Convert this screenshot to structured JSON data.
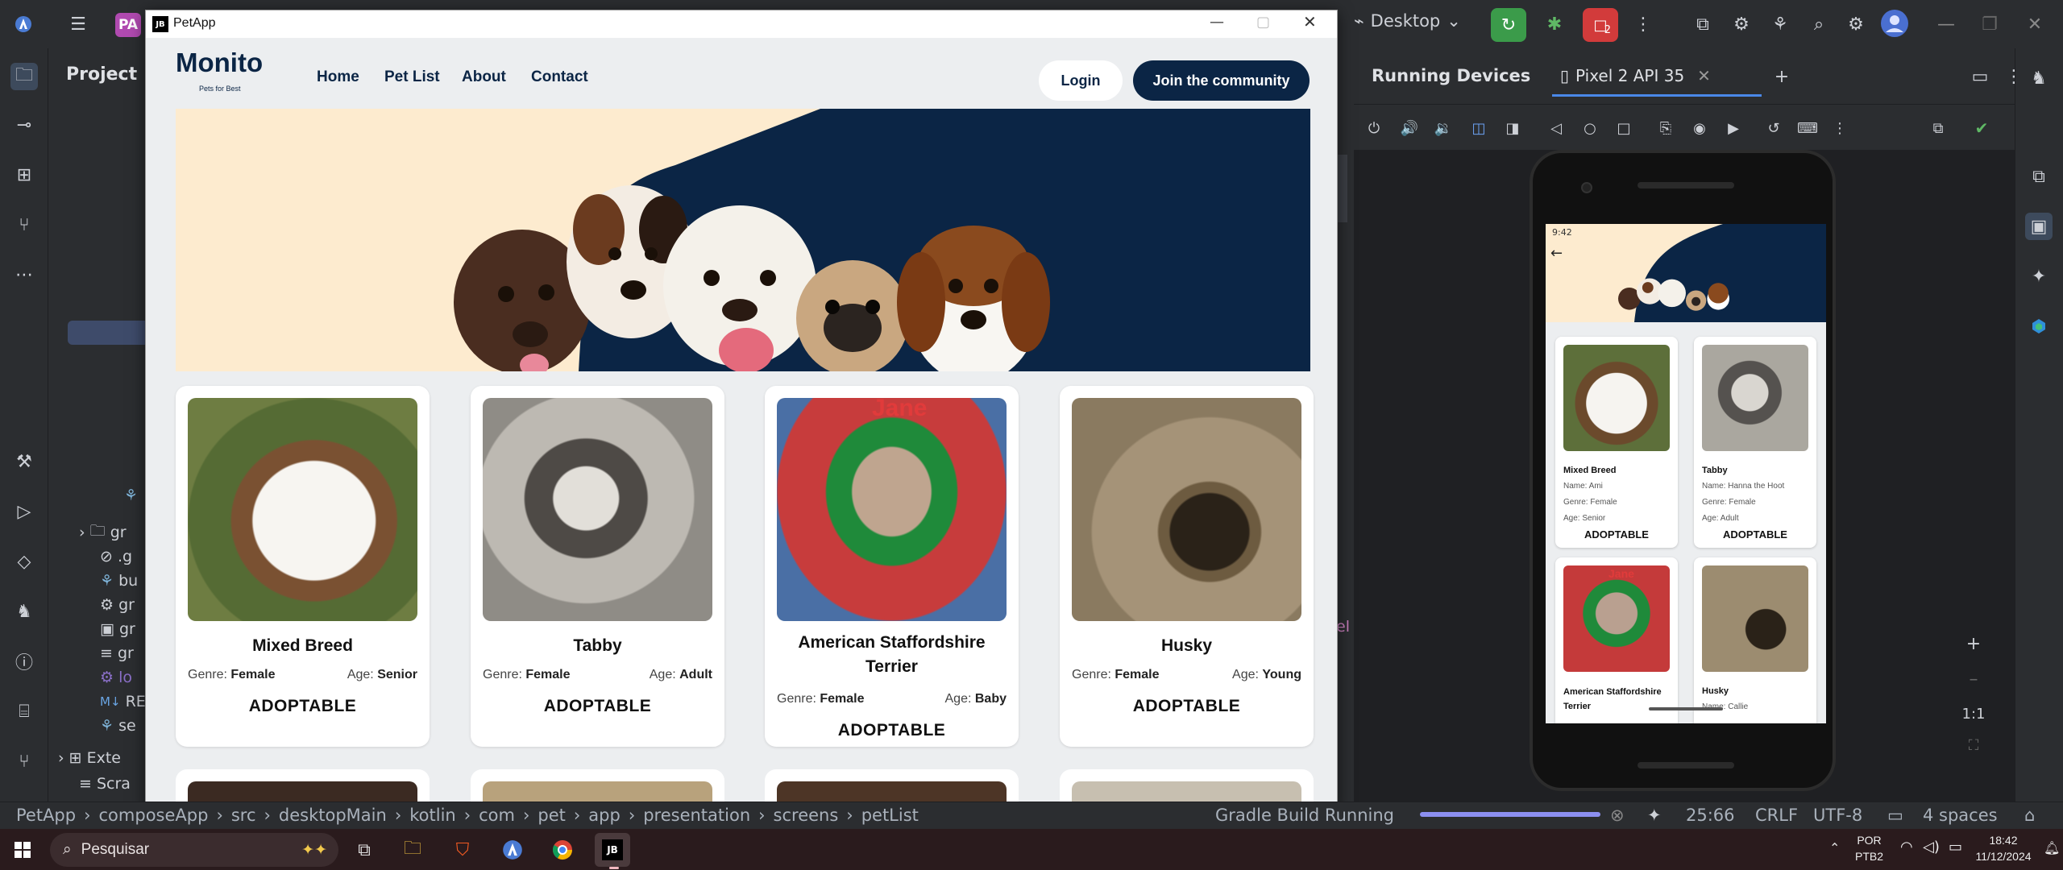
{
  "ide": {
    "project_badge": "PA",
    "project_tab": "Project",
    "run_config": "Desktop",
    "running_devices": "Running Devices",
    "device_tab": "Pixel 2 API 35",
    "zoom": "1:1",
    "el_fragment": "el",
    "tree": [
      "gr",
      ".g",
      "bu",
      "gr",
      "gr",
      "gr",
      "lo",
      "RE",
      "se",
      "Exte",
      "Scra"
    ],
    "status": {
      "breadcrumb": [
        "PetApp",
        "composeApp",
        "src",
        "desktopMain",
        "kotlin",
        "com",
        "pet",
        "app",
        "presentation",
        "screens",
        "petList"
      ],
      "build": "Gradle Build Running",
      "position": "25:66",
      "line_sep": "CRLF",
      "encoding": "UTF-8",
      "indent": "4 spaces"
    },
    "badges": {
      "alerts": "2"
    },
    "colors": {
      "accent_green": "#3b9b4a",
      "accent_red": "#d23b3b",
      "progress": "#8c8ff0"
    }
  },
  "taskbar": {
    "search_placeholder": "Pesquisar",
    "lang": "POR",
    "layout": "PTB2",
    "time": "18:42",
    "date": "11/12/2024",
    "apps": [
      "start-icon",
      "search-icon",
      "task-view-icon",
      "file-explorer-icon",
      "brave-icon",
      "android-studio-icon",
      "chrome-icon",
      "jetbrains-icon"
    ]
  },
  "petapp": {
    "window_title": "PetApp",
    "window_logo": "JB",
    "logo": "Monito",
    "logo_tagline": "Pets for Best",
    "nav": [
      "Home",
      "Pet List",
      "About",
      "Contact"
    ],
    "login": "Login",
    "join": "Join the community",
    "genre_label": "Genre:",
    "age_label": "Age:",
    "pets": [
      {
        "name": "Mixed Breed",
        "genre": "Female",
        "age": "Senior",
        "status": "ADOPTABLE"
      },
      {
        "name": "Tabby",
        "genre": "Female",
        "age": "Adult",
        "status": "ADOPTABLE"
      },
      {
        "name": "American Staffordshire Terrier",
        "genre": "Female",
        "age": "Baby",
        "status": "ADOPTABLE",
        "photo_text": "Jane"
      },
      {
        "name": "Husky",
        "genre": "Female",
        "age": "Young",
        "status": "ADOPTABLE"
      }
    ],
    "colors": {
      "navy": "#0b2545",
      "cream": "#fdebcf",
      "bg": "#eceef0"
    }
  },
  "phone": {
    "status_time": "9:42",
    "pets": [
      {
        "name": "Mixed Breed",
        "pet_name": "Name: Ami",
        "genre": "Genre: Female",
        "age": "Age: Senior",
        "status": "ADOPTABLE"
      },
      {
        "name": "Tabby",
        "pet_name": "Name: Hanna the Hoot",
        "genre": "Genre: Female",
        "age": "Age: Adult",
        "status": "ADOPTABLE"
      },
      {
        "name": "American Staffordshire Terrier",
        "pet_name": "",
        "genre": "",
        "age": "",
        "status": "",
        "photo_text": "Jane"
      },
      {
        "name": "Husky",
        "pet_name": "Name: Callie",
        "genre": "",
        "age": "",
        "status": ""
      }
    ]
  }
}
